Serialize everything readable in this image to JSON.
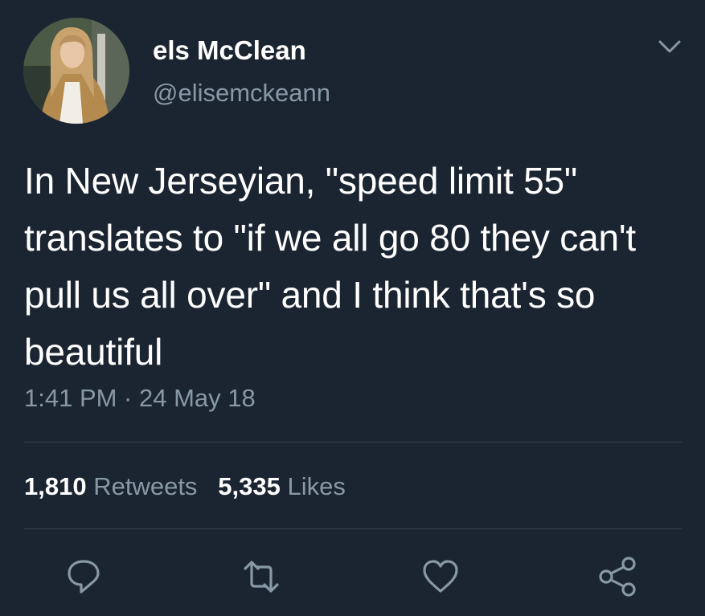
{
  "user": {
    "display_name": "els McClean",
    "handle": "@elisemckeann",
    "avatar_icon": "profile-photo"
  },
  "tweet": {
    "text": "In New Jerseyian, \"speed limit 55\" translates to \"if we all go 80 they can't pull us all over\" and I think that's so beautiful",
    "timestamp": "1:41 PM · 24 May 18"
  },
  "stats": {
    "retweets_count": "1,810",
    "retweets_label": "Retweets",
    "likes_count": "5,335",
    "likes_label": "Likes"
  },
  "actions": {
    "reply_icon": "reply-icon",
    "retweet_icon": "retweet-icon",
    "like_icon": "heart-icon",
    "share_icon": "share-icon",
    "menu_icon": "chevron-down-icon"
  },
  "colors": {
    "background": "#1b2531",
    "primary_text": "#ffffff",
    "secondary_text": "#8899a6",
    "divider": "#38444d"
  }
}
